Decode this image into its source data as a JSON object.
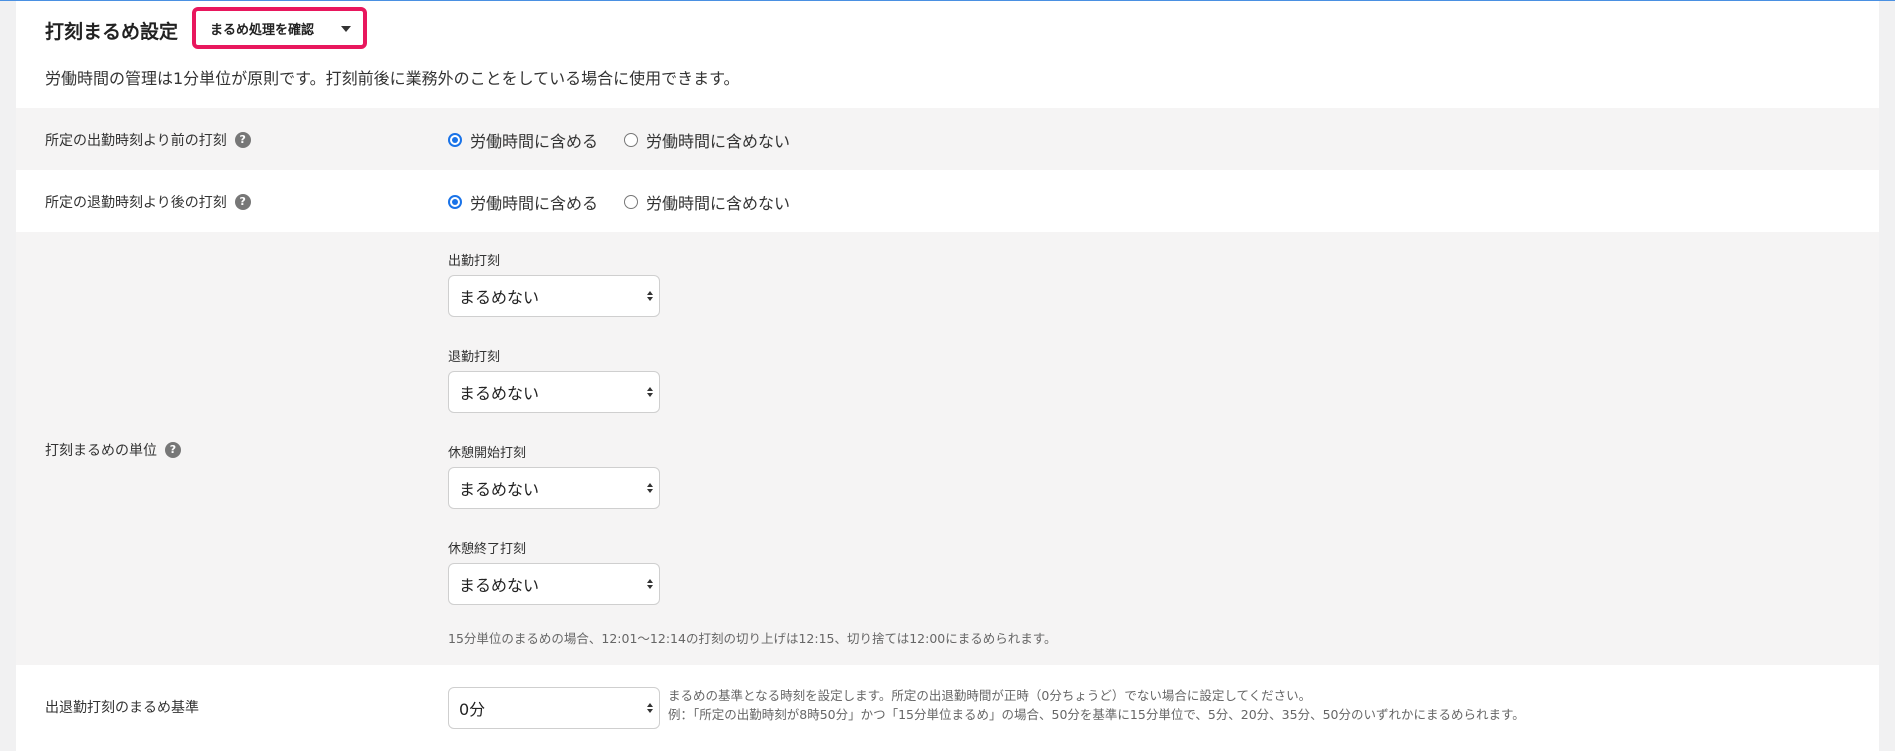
{
  "header": {
    "title": "打刻まるめ設定",
    "check_button_label": "まるめ処理を確認",
    "description": "労働時間の管理は1分単位が原則です。打刻前後に業務外のことをしている場合に使用できます。"
  },
  "before_start": {
    "label": "所定の出勤時刻より前の打刻",
    "options": [
      "労働時間に含める",
      "労働時間に含めない"
    ],
    "selected": "労働時間に含める"
  },
  "after_end": {
    "label": "所定の退勤時刻より後の打刻",
    "options": [
      "労働時間に含める",
      "労働時間に含めない"
    ],
    "selected": "労働時間に含める"
  },
  "rounding_unit": {
    "label": "打刻まるめの単位",
    "fields": [
      {
        "label": "出勤打刻",
        "value": "まるめない"
      },
      {
        "label": "退勤打刻",
        "value": "まるめない"
      },
      {
        "label": "休憩開始打刻",
        "value": "まるめない"
      },
      {
        "label": "休憩終了打刻",
        "value": "まるめない"
      }
    ],
    "note": "15分単位のまるめの場合、12:01～12:14の打刻の切り上げは12:15、切り捨ては12:00にまるめられます。"
  },
  "rounding_base": {
    "label": "出退勤打刻のまるめ基準",
    "value": "0分",
    "note_line1": "まるめの基準となる時刻を設定します。所定の出退勤時間が正時（0分ちょうど）でない場合に設定してください。",
    "note_line2": "例：「所定の出勤時刻が8時50分」かつ「15分単位まるめ」の場合、50分を基準に15分単位で、5分、20分、35分、50分のいずれかにまるめられます。"
  },
  "icons": {
    "help": "help-icon",
    "dropdown": "caret-down-icon",
    "select": "select-arrows-icon"
  },
  "colors": {
    "accent": "#1a73e8",
    "highlight_border": "#e8175d"
  }
}
